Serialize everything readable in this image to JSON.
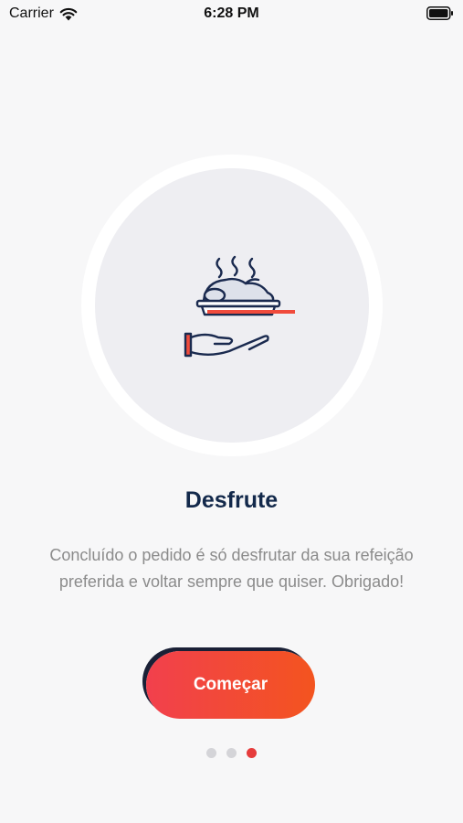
{
  "status_bar": {
    "carrier": "Carrier",
    "wifi_icon": "wifi-icon",
    "time": "6:28 PM",
    "battery_icon": "battery-icon"
  },
  "hero": {
    "icon": "serving-plate-hand-icon"
  },
  "onboarding": {
    "title": "Desfrute",
    "description": "Concluído o pedido é só desfrutar da sua refeição preferida e voltar sempre que quiser. Obrigado!",
    "button_label": "Começar",
    "page_count": 3,
    "active_page": 3
  },
  "colors": {
    "title": "#13294b",
    "button_start": "#f2404d",
    "button_end": "#f3541f",
    "dot_active": "#e63c3c",
    "dot_inactive": "#d4d4d8",
    "icon_navy": "#1a2a4f",
    "icon_accent": "#f04b3c"
  }
}
